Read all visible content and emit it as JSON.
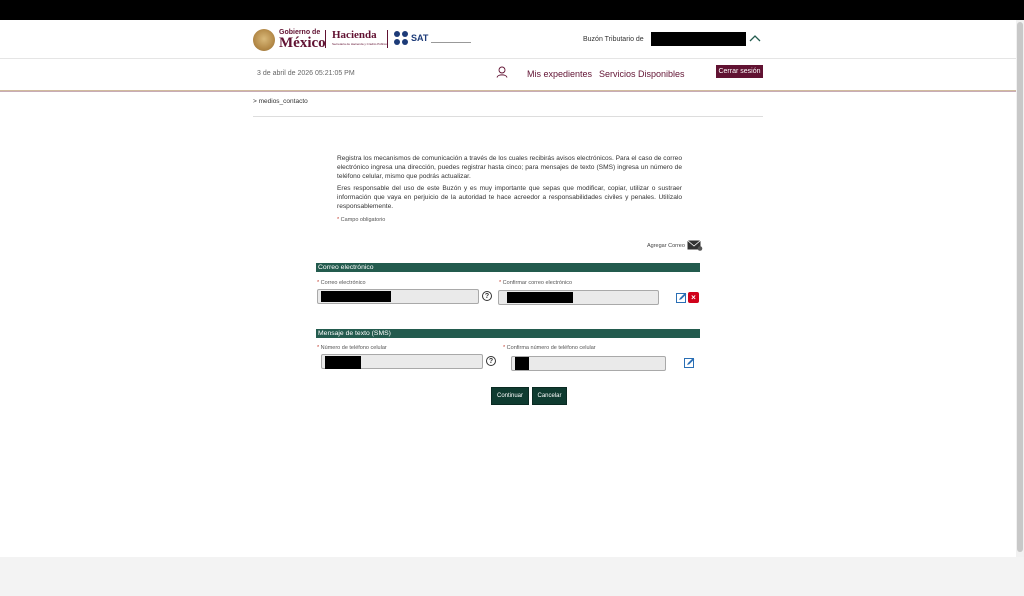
{
  "header": {
    "gob_small": "Gobierno de",
    "gob_big": "México",
    "hacienda_title": "Hacienda",
    "hacienda_sub": "Secretaría de Hacienda y Crédito Público",
    "sat_label": "SAT",
    "buzon_label": "Buzón Tributario de"
  },
  "nav": {
    "datetime": "3 de abril de 2026 05:21:05 PM",
    "mis_expedientes": "Mis expedientes",
    "servicios": "Servicios Disponibles",
    "logout": "Cerrar sesión"
  },
  "breadcrumb": "> medios_contacto",
  "intro": {
    "p1": "Registra los mecanismos de comunicación a través de los cuales recibirás avisos electrónicos. Para el caso de correo electrónico ingresa una dirección, puedes registrar hasta cinco; para mensajes de texto (SMS) ingresa un número de teléfono celular, mismo que podrás actualizar.",
    "p2": "Eres responsable del uso de este Buzón y es muy importante que sepas que modificar, copiar, utilizar o sustraer información que vaya en perjuicio de la autoridad te hace acreedor a responsabilidades civiles y penales. Utilízalo responsablemente.",
    "required_note": "Campo obligatorio",
    "required_star": "*"
  },
  "add_mail": "Agregar Correo",
  "email_section": {
    "title": "Correo electrónico",
    "email_label": "Correo electrónico",
    "confirm_label": "Confirmar correo electrónico"
  },
  "sms_section": {
    "title": "Mensaje de texto (SMS)",
    "phone_label": "Número de teléfono celular",
    "confirm_label": "Confirma número de teléfono celular"
  },
  "buttons": {
    "continue": "Continuar",
    "cancel": "Cancelar"
  },
  "icons": {
    "help": "?",
    "delete": "×"
  },
  "colors": {
    "brand_guinda": "#611232",
    "section_green": "#235b4e",
    "button_green": "#0f3b30"
  }
}
